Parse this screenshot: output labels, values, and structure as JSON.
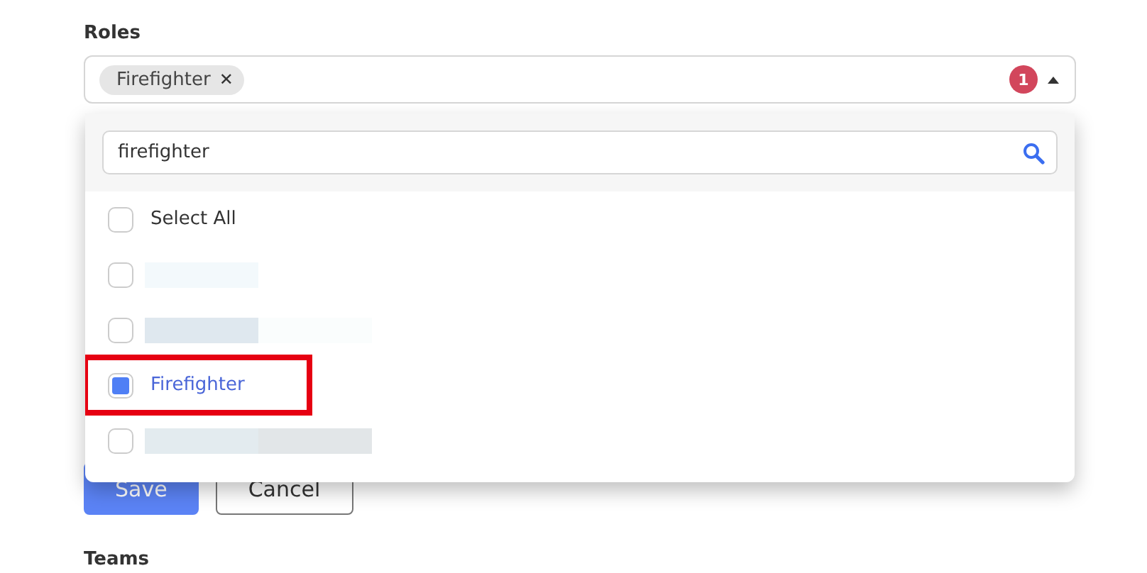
{
  "roles": {
    "label": "Roles",
    "chips": [
      {
        "label": "Firefighter",
        "remove": "✕"
      }
    ],
    "count": "1",
    "expanded": true
  },
  "dropdown": {
    "search": {
      "value": "firefighter"
    },
    "options": [
      {
        "kind": "text",
        "label": "Select All",
        "checked": false,
        "highlighted": false
      },
      {
        "kind": "redacted",
        "checked": false,
        "segments": [
          {
            "color": "#f3f9fc"
          }
        ]
      },
      {
        "kind": "redacted",
        "checked": false,
        "segments": [
          {
            "color": "#dfe8ef"
          },
          {
            "color": "#fafdfd"
          }
        ]
      },
      {
        "kind": "text",
        "label": "Firefighter",
        "checked": true,
        "highlighted": true
      },
      {
        "kind": "redacted",
        "checked": false,
        "segments": [
          {
            "color": "#e3ebef"
          },
          {
            "color": "#e2e6e8"
          }
        ]
      }
    ]
  },
  "buttons": [
    {
      "kind": "primary",
      "label": "Save"
    },
    {
      "kind": "secondary",
      "label": "Cancel"
    }
  ],
  "teams": {
    "label": "Teams"
  }
}
